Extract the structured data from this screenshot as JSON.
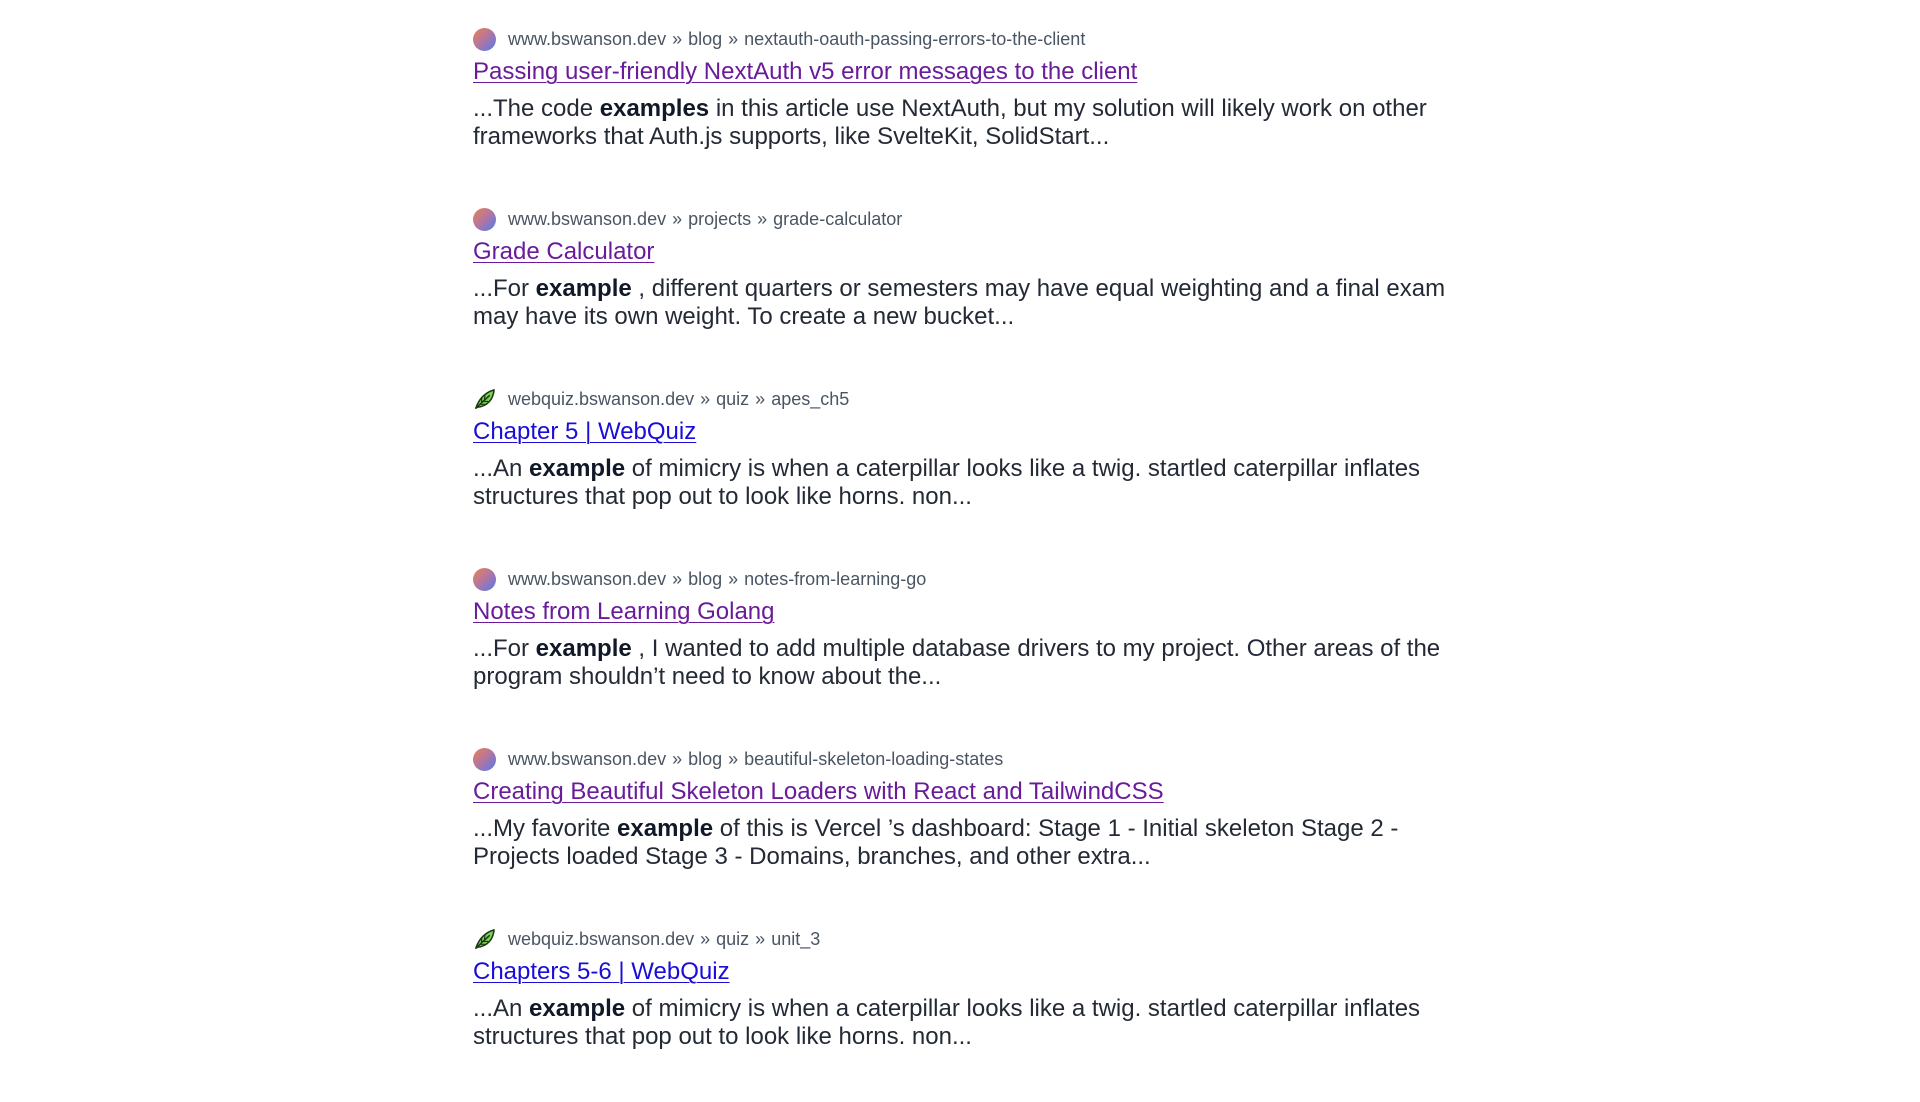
{
  "results": [
    {
      "favicon": "gradient-circle-icon",
      "domain": "www.bswanson.dev",
      "path": [
        "blog",
        "nextauth-oauth-passing-errors-to-the-client"
      ],
      "title": "Passing user-friendly NextAuth v5 error messages to the client",
      "visited": true,
      "snippet_before": "...The code ",
      "snippet_bold": "examples",
      "snippet_after": " in this article use NextAuth, but my solution will likely work on other frameworks that Auth.js supports, like SvelteKit, SolidStart..."
    },
    {
      "favicon": "gradient-circle-icon",
      "domain": "www.bswanson.dev",
      "path": [
        "projects",
        "grade-calculator"
      ],
      "title": "Grade Calculator",
      "visited": true,
      "snippet_before": "...For ",
      "snippet_bold": "example",
      "snippet_after": " , different quarters or semesters may have equal weighting and a final exam may have its own weight. To create a new bucket..."
    },
    {
      "favicon": "leaf-icon",
      "domain": "webquiz.bswanson.dev",
      "path": [
        "quiz",
        "apes_ch5"
      ],
      "title": "Chapter 5 | WebQuiz",
      "visited": false,
      "snippet_before": "...An ",
      "snippet_bold": "example",
      "snippet_after": " of mimicry is when a caterpillar looks like a twig. startled caterpillar inflates structures that pop out to look like horns. non..."
    },
    {
      "favicon": "gradient-circle-icon",
      "domain": "www.bswanson.dev",
      "path": [
        "blog",
        "notes-from-learning-go"
      ],
      "title": "Notes from Learning Golang",
      "visited": true,
      "snippet_before": "...For ",
      "snippet_bold": "example",
      "snippet_after": " , I wanted to add multiple database drivers to my project. Other areas of the program shouldn’t need to know about the..."
    },
    {
      "favicon": "gradient-circle-icon",
      "domain": "www.bswanson.dev",
      "path": [
        "blog",
        "beautiful-skeleton-loading-states"
      ],
      "title": "Creating Beautiful Skeleton Loaders with React and TailwindCSS",
      "visited": true,
      "snippet_before": "...My favorite ",
      "snippet_bold": "example",
      "snippet_after": " of this is Vercel ’s dashboard: Stage 1 - Initial skeleton Stage 2 - Projects loaded Stage 3 - Domains, branches, and other extra..."
    },
    {
      "favicon": "leaf-icon",
      "domain": "webquiz.bswanson.dev",
      "path": [
        "quiz",
        "unit_3"
      ],
      "title": "Chapters 5-6 | WebQuiz",
      "visited": false,
      "snippet_before": "...An ",
      "snippet_bold": "example",
      "snippet_after": " of mimicry is when a caterpillar looks like a twig. startled caterpillar inflates structures that pop out to look like horns. non..."
    }
  ],
  "crumb_separator": "»",
  "colors": {
    "visited_link": "#6a1b9a",
    "unvisited_link": "#1a0dd8",
    "crumb_text": "#4a5563",
    "snippet_text": "#242a35"
  }
}
